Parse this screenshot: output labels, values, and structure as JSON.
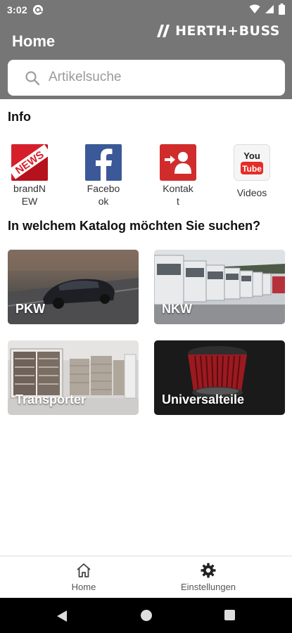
{
  "status": {
    "time": "3:02"
  },
  "appbar": {
    "title": "Home",
    "brand": "HERTH+BUSS"
  },
  "search": {
    "placeholder": "Artikelsuche"
  },
  "info": {
    "title": "Info",
    "items": [
      {
        "label": "brandN\nEW",
        "icon": "news-icon"
      },
      {
        "label": "Facebo\nok",
        "icon": "facebook-icon"
      },
      {
        "label": "Kontak\nt",
        "icon": "contact-icon"
      },
      {
        "label": "Videos",
        "icon": "youtube-icon"
      }
    ]
  },
  "katalog": {
    "title": "In welchem Katalog möchten Sie suchen?",
    "cards": [
      {
        "label": "PKW"
      },
      {
        "label": "NKW"
      },
      {
        "label": "Transporter"
      },
      {
        "label": "Universalteile"
      }
    ]
  },
  "bottom_nav": {
    "home": "Home",
    "settings": "Einstellungen"
  },
  "colors": {
    "appbar": "#767676",
    "news_red": "#d5202c",
    "facebook_blue": "#3b5998",
    "contact_red": "#d12c2c",
    "youtube_red": "#e52d27"
  }
}
